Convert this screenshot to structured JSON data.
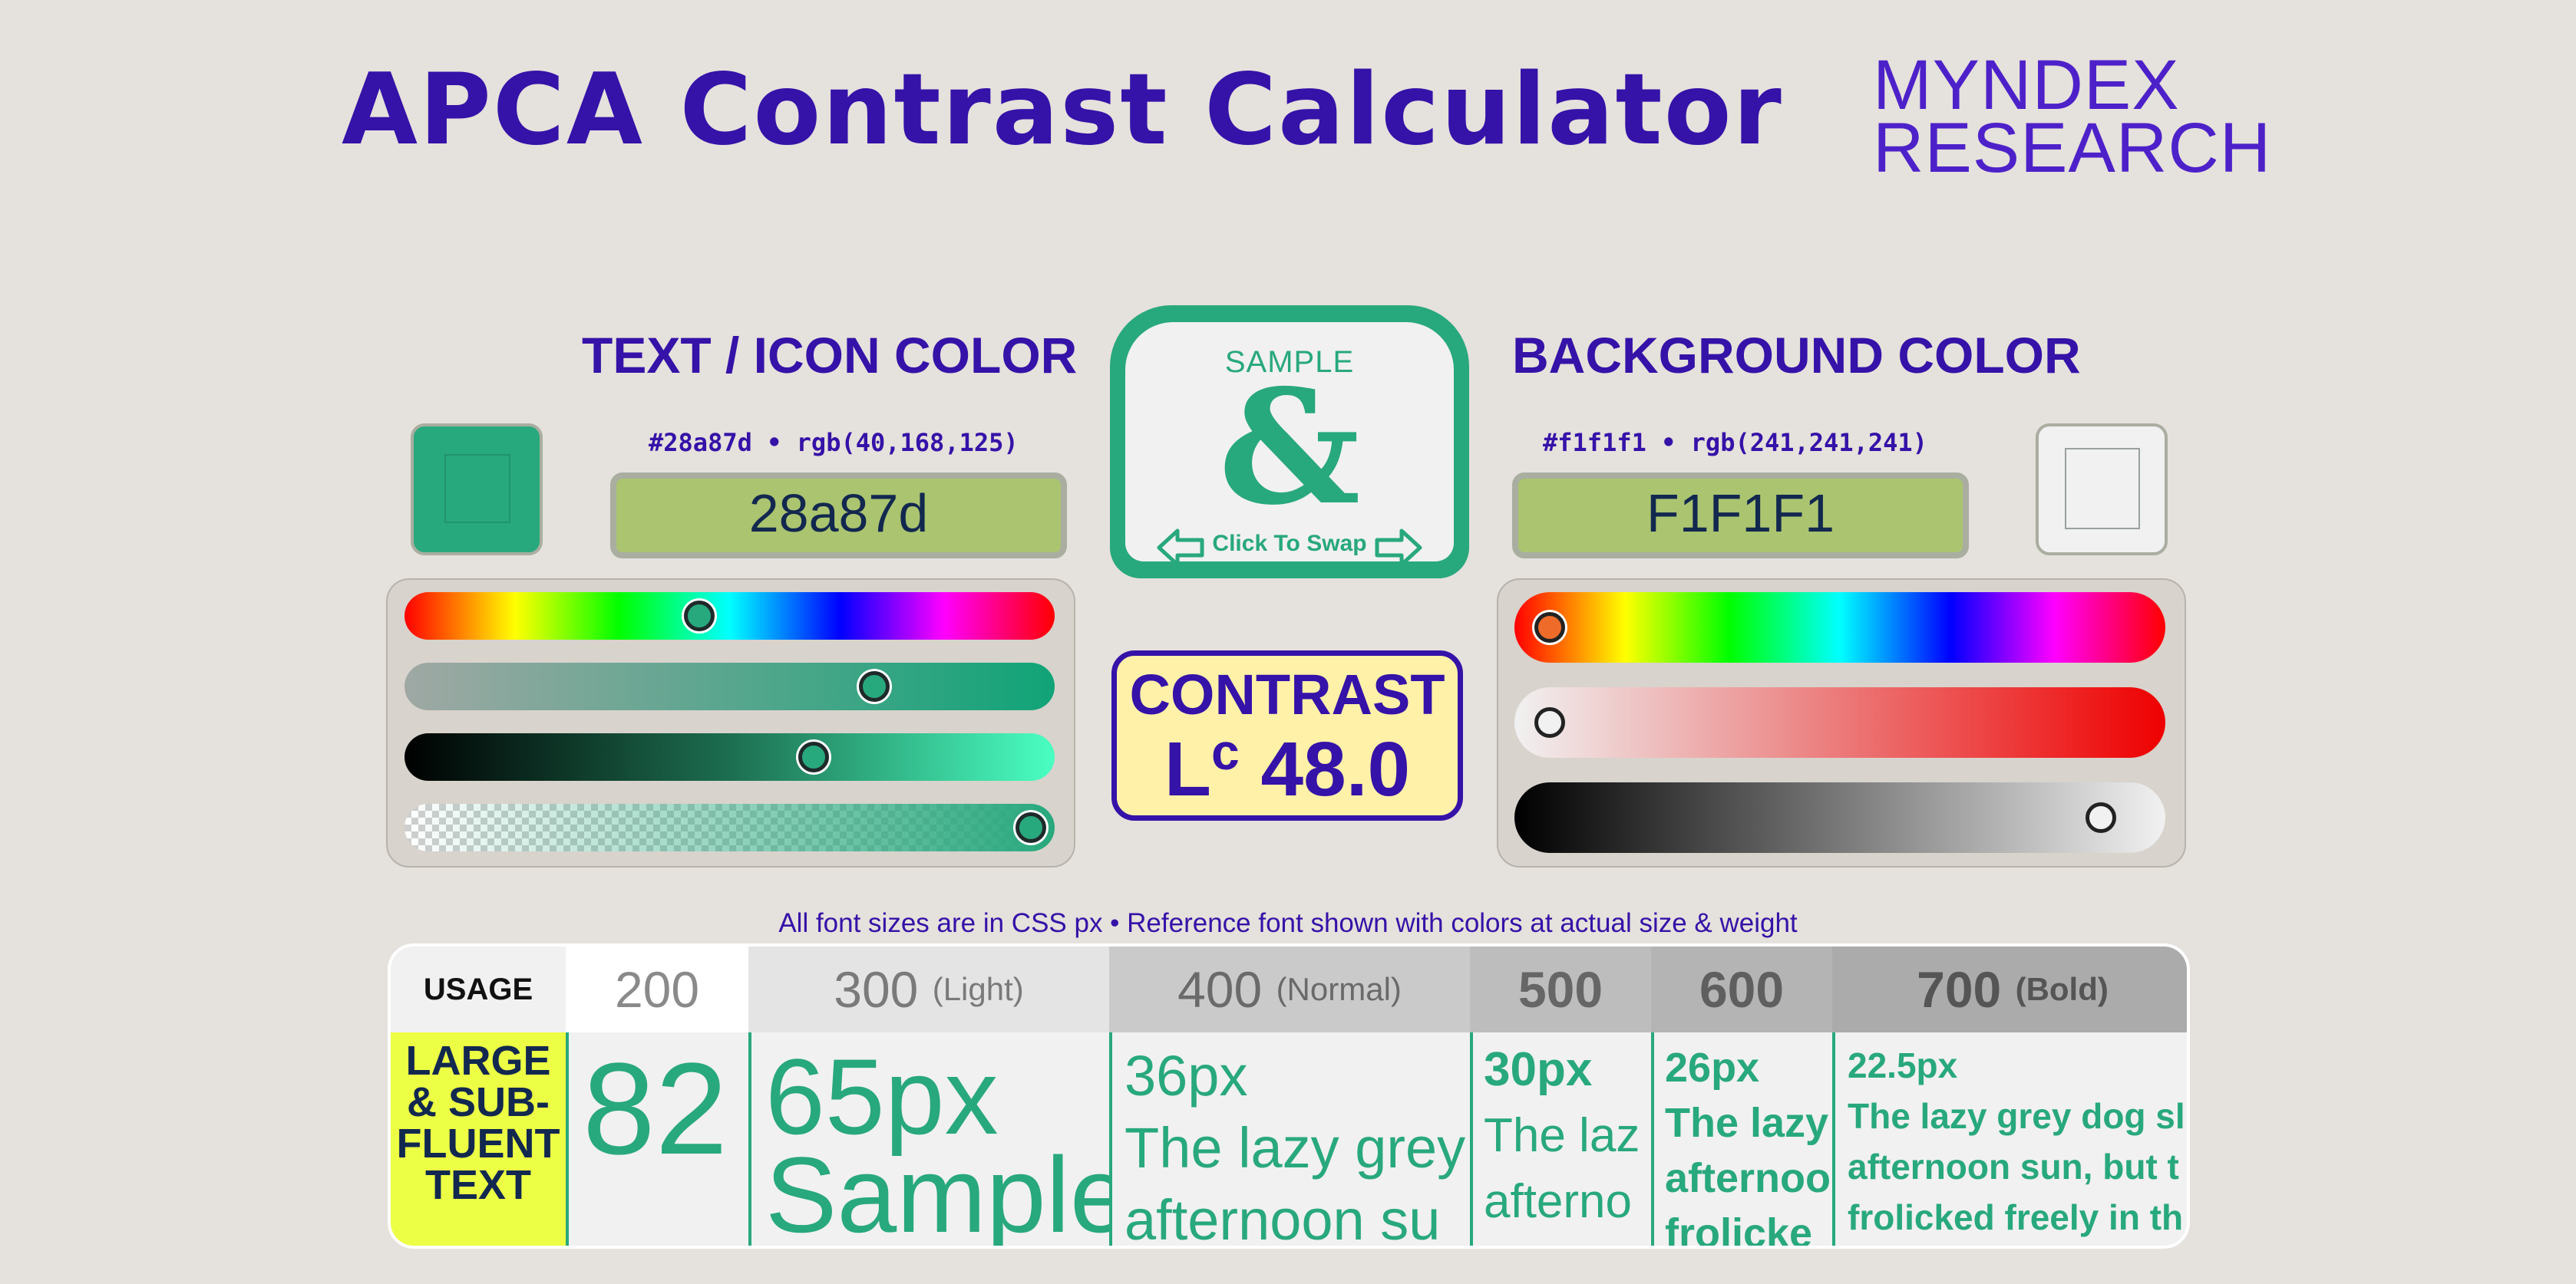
{
  "header": {
    "title": "APCA Contrast Calculator",
    "brand_line1": "MYNDEX",
    "brand_line2": "RESEARCH"
  },
  "text_color": {
    "heading": "TEXT / ICON COLOR",
    "info": "#28a87d • rgb(40,168,125)",
    "hex_value": "28a87d",
    "swatch_color": "#28a87d",
    "sliders": {
      "hue": 0.45,
      "saturation": 0.74,
      "lightness": 0.64,
      "alpha": 1.0
    }
  },
  "background_color": {
    "heading": "BACKGROUND COLOR",
    "info": "#f1f1f1 • rgb(241,241,241)",
    "hex_value": "F1F1F1",
    "swatch_color": "#f1f1f1",
    "sliders": {
      "hue": 0.0,
      "saturation": 0.0,
      "lightness": 0.95
    }
  },
  "swap": {
    "sample": "SAMPLE",
    "glyph": "&",
    "label": "Click To Swap",
    "left_arrow_icon": "arrow-left-icon",
    "right_arrow_icon": "arrow-right-icon"
  },
  "contrast": {
    "title": "CONTRAST",
    "prefix": "L",
    "prefix_sup": "c",
    "value": "48.0"
  },
  "table": {
    "note": "All font sizes are in CSS px • Reference font shown with colors at actual size & weight",
    "usage_label": "USAGE",
    "usage_lines": [
      "LARGE",
      "& SUB-",
      "FLUENT",
      "TEXT"
    ],
    "weights": [
      {
        "weight": "200",
        "desc": ""
      },
      {
        "weight": "300",
        "desc": "(Light)"
      },
      {
        "weight": "400",
        "desc": "(Normal)"
      },
      {
        "weight": "500",
        "desc": ""
      },
      {
        "weight": "600",
        "desc": ""
      },
      {
        "weight": "700",
        "desc": "(Bold)"
      }
    ],
    "samples": [
      {
        "size": "82",
        "lines": []
      },
      {
        "size": "65px",
        "lines": [
          "Sample"
        ]
      },
      {
        "size": "36px",
        "lines": [
          "The lazy grey",
          "afternoon su"
        ]
      },
      {
        "size": "30px",
        "lines": [
          "The laz",
          "afterno"
        ]
      },
      {
        "size": "26px",
        "lines": [
          "The lazy",
          "afternoo",
          "frolicke"
        ]
      },
      {
        "size": "22.5px",
        "lines": [
          "The lazy grey dog sl",
          "afternoon sun, but t",
          "frolicked freely in th"
        ]
      }
    ]
  },
  "colors": {
    "accent": "#3512a8",
    "text_sample": "#28a87d",
    "background_sample": "#f1f1f1",
    "hex_field": "#abc46f",
    "result_box": "#fff1a8",
    "usage_highlight": "#ecff45"
  }
}
